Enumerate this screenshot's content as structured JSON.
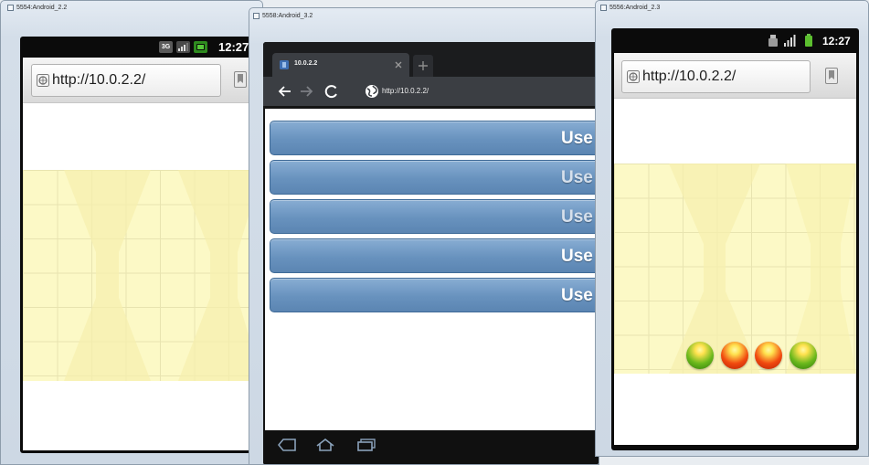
{
  "windows": {
    "left": {
      "title": "5554:Android_2.2",
      "status_bar": {
        "network_label": "3G",
        "icons": [
          "signal-icon",
          "battery-icon"
        ],
        "time": "12:27"
      },
      "browser": {
        "url": "http://10.0.2.2/",
        "icons": [
          "page-icon",
          "bookmark-icon"
        ]
      }
    },
    "middle": {
      "title": "5558:Android_3.2",
      "tab": {
        "title": "10.0.2.2",
        "icons": [
          "page-favicon-icon",
          "close-icon"
        ]
      },
      "toolbar_icons": [
        "new-tab-icon",
        "back-arrow-icon",
        "forward-arrow-icon",
        "reload-icon",
        "globe-icon"
      ],
      "url": "http://10.0.2.2/",
      "buttons": [
        {
          "label": "Use",
          "text_color": "#ffffff"
        },
        {
          "label": "Use",
          "text_color": "#d6e0ec"
        },
        {
          "label": "Use",
          "text_color": "#d6e0ec"
        },
        {
          "label": "Use",
          "text_color": "#ffffff"
        },
        {
          "label": "Use",
          "text_color": "#ffffff"
        }
      ],
      "system_bar_icons": [
        "back-nav-icon",
        "home-nav-icon",
        "recent-apps-icon"
      ]
    },
    "right": {
      "title": "5556:Android_2.3",
      "status_bar": {
        "icons": [
          "usb-icon",
          "signal-icon",
          "battery-icon"
        ],
        "time": "12:27"
      },
      "browser": {
        "url": "http://10.0.2.2/",
        "icons": [
          "page-icon",
          "bookmark-icon"
        ]
      },
      "indicator_lights": [
        {
          "color": "#6ab81c",
          "shade": "#2e7a0a"
        },
        {
          "color": "#f1490f",
          "shade": "#b52206"
        },
        {
          "color": "#f1490f",
          "shade": "#b52206"
        },
        {
          "color": "#6ab81c",
          "shade": "#2e7a0a"
        }
      ]
    }
  },
  "colors": {
    "button_blue": "#6892be",
    "grid_yellow": "#fcf9c6",
    "device_black": "#0b0b0b",
    "window_frame": "#d4dee9"
  }
}
